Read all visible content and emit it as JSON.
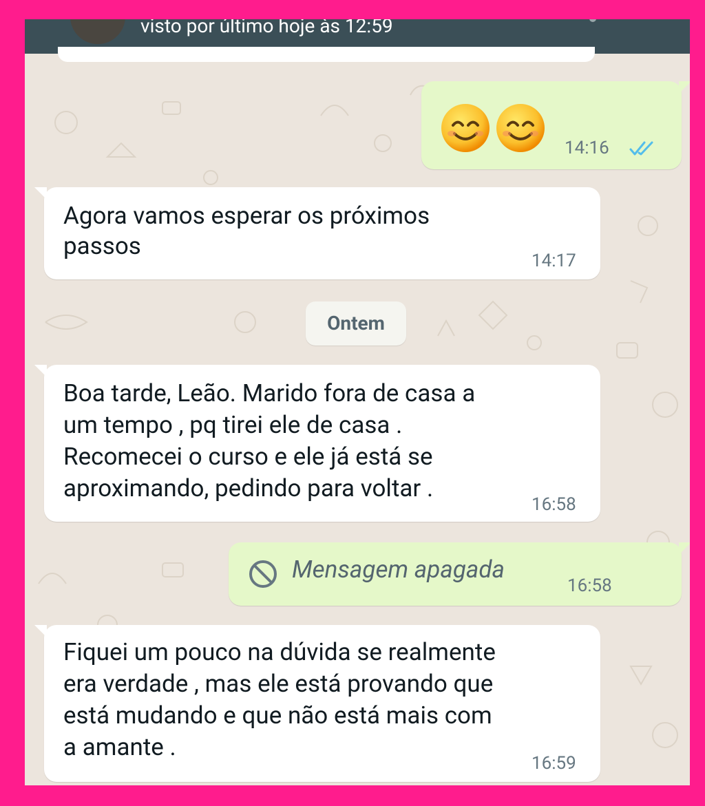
{
  "header": {
    "status": "visto por último hoje às 12:59"
  },
  "messages": [
    {
      "direction": "outgoing",
      "content": "😊😊",
      "time": "14:16",
      "status": "read"
    },
    {
      "direction": "incoming",
      "lines": [
        "Agora vamos esperar os próximos",
        "passos"
      ],
      "time": "14:17"
    },
    {
      "direction": "date-separator",
      "label": "Ontem"
    },
    {
      "direction": "incoming",
      "lines": [
        "Boa tarde, Leão. Marido fora de casa a",
        "um tempo , pq tirei ele de casa .",
        "Recomecei o curso e ele já está se",
        "aproximando, pedindo para voltar ."
      ],
      "time": "16:58"
    },
    {
      "direction": "outgoing",
      "deleted": true,
      "text": "Mensagem apagada",
      "time": "16:58"
    },
    {
      "direction": "incoming",
      "lines": [
        "Fiquei um pouco na dúvida se realmente",
        "era verdade , mas ele está provando que",
        "está mudando e que não está mais com",
        "a amante ."
      ],
      "time": "16:59"
    }
  ],
  "icons": {
    "read_receipt": "double-check-icon",
    "deleted": "ban-icon",
    "emoji": "smiling-face-icon"
  },
  "colors": {
    "frame_border": "#ff1c8d",
    "header": "#3b4f57",
    "chat_background": "#ece5dd",
    "incoming_bubble": "#ffffff",
    "outgoing_bubble": "#e5f8c9",
    "read_tick": "#53bdeb"
  }
}
